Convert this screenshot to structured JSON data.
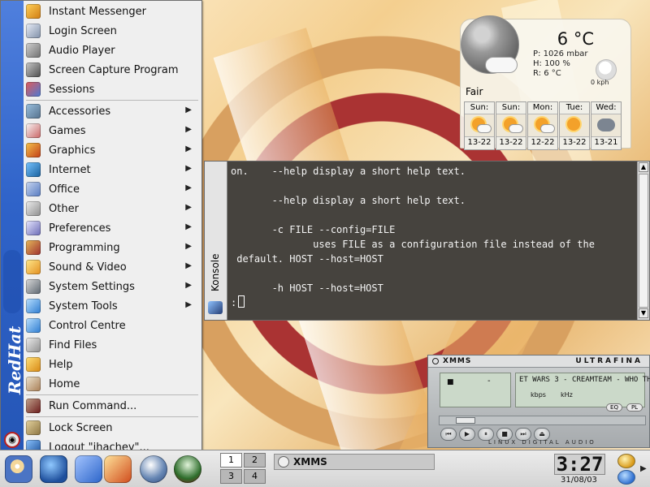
{
  "menu": {
    "brand": "RedHat",
    "top_items": [
      {
        "label": "Instant Messenger",
        "icon": "instant-messenger-icon"
      },
      {
        "label": "Login Screen",
        "icon": "login-screen-icon"
      },
      {
        "label": "Audio Player",
        "icon": "audio-player-icon"
      },
      {
        "label": "Screen Capture Program",
        "icon": "screen-capture-icon"
      },
      {
        "label": "Sessions",
        "icon": "sessions-icon"
      }
    ],
    "category_items": [
      {
        "label": "Accessories",
        "icon": "accessories-icon"
      },
      {
        "label": "Games",
        "icon": "games-icon"
      },
      {
        "label": "Graphics",
        "icon": "graphics-icon"
      },
      {
        "label": "Internet",
        "icon": "internet-icon"
      },
      {
        "label": "Office",
        "icon": "office-icon"
      },
      {
        "label": "Other",
        "icon": "other-icon"
      },
      {
        "label": "Preferences",
        "icon": "preferences-icon"
      },
      {
        "label": "Programming",
        "icon": "programming-icon"
      },
      {
        "label": "Sound & Video",
        "icon": "sound-video-icon"
      },
      {
        "label": "System Settings",
        "icon": "system-settings-icon"
      },
      {
        "label": "System Tools",
        "icon": "system-tools-icon"
      }
    ],
    "utility_items": [
      {
        "label": "Control Centre",
        "icon": "control-centre-icon"
      },
      {
        "label": "Find Files",
        "icon": "find-files-icon"
      },
      {
        "label": "Help",
        "icon": "help-icon"
      },
      {
        "label": "Home",
        "icon": "home-icon"
      }
    ],
    "run_item": {
      "label": "Run Command...",
      "icon": "run-command-icon"
    },
    "session_items": [
      {
        "label": "Lock Screen",
        "icon": "lock-screen-icon"
      },
      {
        "label": "Logout \"jhachey\"...",
        "icon": "logout-icon"
      }
    ]
  },
  "weather": {
    "temperature": "6 °C",
    "pressure": "P:  1026 mbar",
    "humidity": "H:  100 %",
    "real_feel": "R:  6 °C",
    "wind": "0 kph",
    "condition": "Fair",
    "forecast": [
      {
        "day": "Sun:",
        "range": "13-22",
        "icon": "sunny-cloud-icon"
      },
      {
        "day": "Sun:",
        "range": "13-22",
        "icon": "sunny-cloud-icon"
      },
      {
        "day": "Mon:",
        "range": "12-22",
        "icon": "sunny-cloud-icon"
      },
      {
        "day": "Tue:",
        "range": "13-22",
        "icon": "sunny-icon"
      },
      {
        "day": "Wed:",
        "range": "13-21",
        "icon": "storm-icon"
      }
    ]
  },
  "konsole": {
    "title": "Konsole",
    "lines": [
      "on.    --help display a short help text.",
      "",
      "       --help display a short help text.",
      "",
      "       -c FILE --config=FILE",
      "              uses FILE as a configuration file instead of the",
      " default. HOST --host=HOST",
      "",
      "       -h HOST --host=HOST",
      "",
      ":"
    ]
  },
  "xmms": {
    "title": "XMMS",
    "skin": "ULTRAFINA",
    "song": "ET WARS 3 - CREAMTEAM - WHO TH",
    "time_marker": "■",
    "time_value": "-",
    "kbps": "kbps",
    "khz": "kHz",
    "eq": "EQ",
    "pl": "PL",
    "footer": "LINUX DIGITAL AUDIO"
  },
  "taskbar": {
    "desktops": [
      "1",
      "2",
      "3",
      "4"
    ],
    "active_desktop": "1",
    "task_label": "XMMS",
    "clock": "3:27",
    "date": "31/08/03"
  }
}
